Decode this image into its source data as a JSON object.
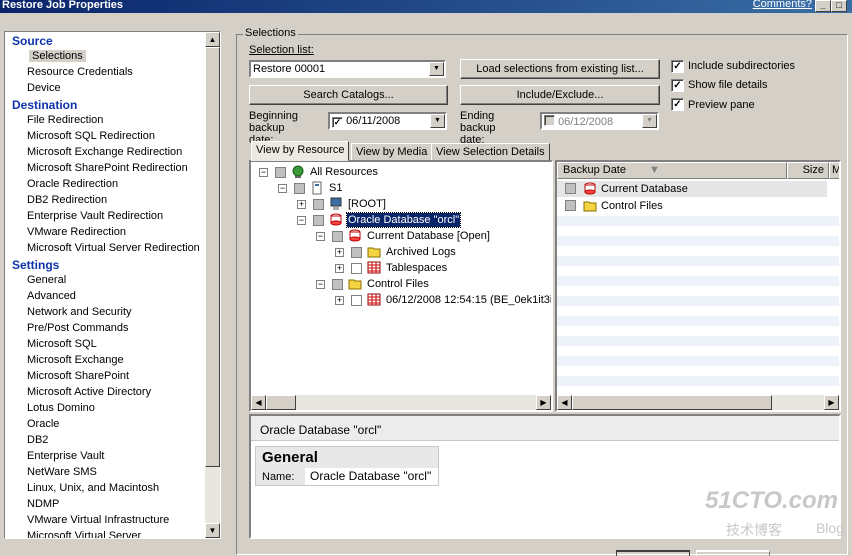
{
  "window": {
    "title": "Restore Job Properties",
    "comments_link": "Comments?"
  },
  "nav": {
    "sections": [
      {
        "heading": "Source",
        "items": [
          "Selections",
          "Resource Credentials",
          "Device"
        ]
      },
      {
        "heading": "Destination",
        "items": [
          "File Redirection",
          "Microsoft SQL Redirection",
          "Microsoft Exchange Redirection",
          "Microsoft SharePoint Redirection",
          "Oracle Redirection",
          "DB2 Redirection",
          "Enterprise Vault Redirection",
          "VMware Redirection",
          "Microsoft Virtual Server Redirection"
        ]
      },
      {
        "heading": "Settings",
        "items": [
          "General",
          "Advanced",
          "Network and Security",
          "Pre/Post Commands",
          "Microsoft SQL",
          "Microsoft Exchange",
          "Microsoft SharePoint",
          "Microsoft Active Directory",
          "Lotus Domino",
          "Oracle",
          "DB2",
          "Enterprise Vault",
          "NetWare SMS",
          "Linux, Unix, and Macintosh",
          "NDMP",
          "VMware Virtual Infrastructure",
          "Microsoft Virtual Server"
        ]
      }
    ],
    "selected": "Selections"
  },
  "selections": {
    "group_label": "Selections",
    "selection_list_label": "Selection list:",
    "selection_list_value": "Restore 00001",
    "load_button": "Load selections from existing list...",
    "search_button": "Search Catalogs...",
    "include_button": "Include/Exclude...",
    "beginning_label": "Beginning backup date:",
    "beginning_value": "06/11/2008",
    "ending_label": "Ending backup date:",
    "ending_value": "06/12/2008",
    "include_subdirs": "Include subdirectories",
    "show_file_details": "Show file details",
    "preview_pane": "Preview pane"
  },
  "tabs": [
    "View by Resource",
    "View by Media",
    "View Selection Details"
  ],
  "tree": [
    {
      "label": "All Resources",
      "icon": "globe-icon"
    },
    {
      "label": "S1",
      "icon": "server-icon"
    },
    {
      "label": "[ROOT]",
      "icon": "computer-icon"
    },
    {
      "label": "Oracle Database \"orcl\"",
      "icon": "database-icon"
    },
    {
      "label": "Current Database [Open]",
      "icon": "database-icon"
    },
    {
      "label": "Archived Logs",
      "icon": "folder-icon"
    },
    {
      "label": "Tablespaces",
      "icon": "table-icon"
    },
    {
      "label": "Control Files",
      "icon": "folder-icon"
    },
    {
      "label": "06/12/2008 12:54:15 (BE_0ek1it3i",
      "icon": "table-icon"
    }
  ],
  "details": {
    "columns": [
      "Backup Date",
      "Size",
      "M"
    ],
    "rows": [
      "Current Database",
      "Control Files"
    ]
  },
  "preview": {
    "title": "Oracle Database \"orcl\"",
    "heading": "General",
    "name_label": "Name:",
    "name_value": "Oracle Database \"orcl\""
  },
  "watermark": {
    "line1": "51CTO.com",
    "line2": "技术博客",
    "line3": "Blog"
  }
}
